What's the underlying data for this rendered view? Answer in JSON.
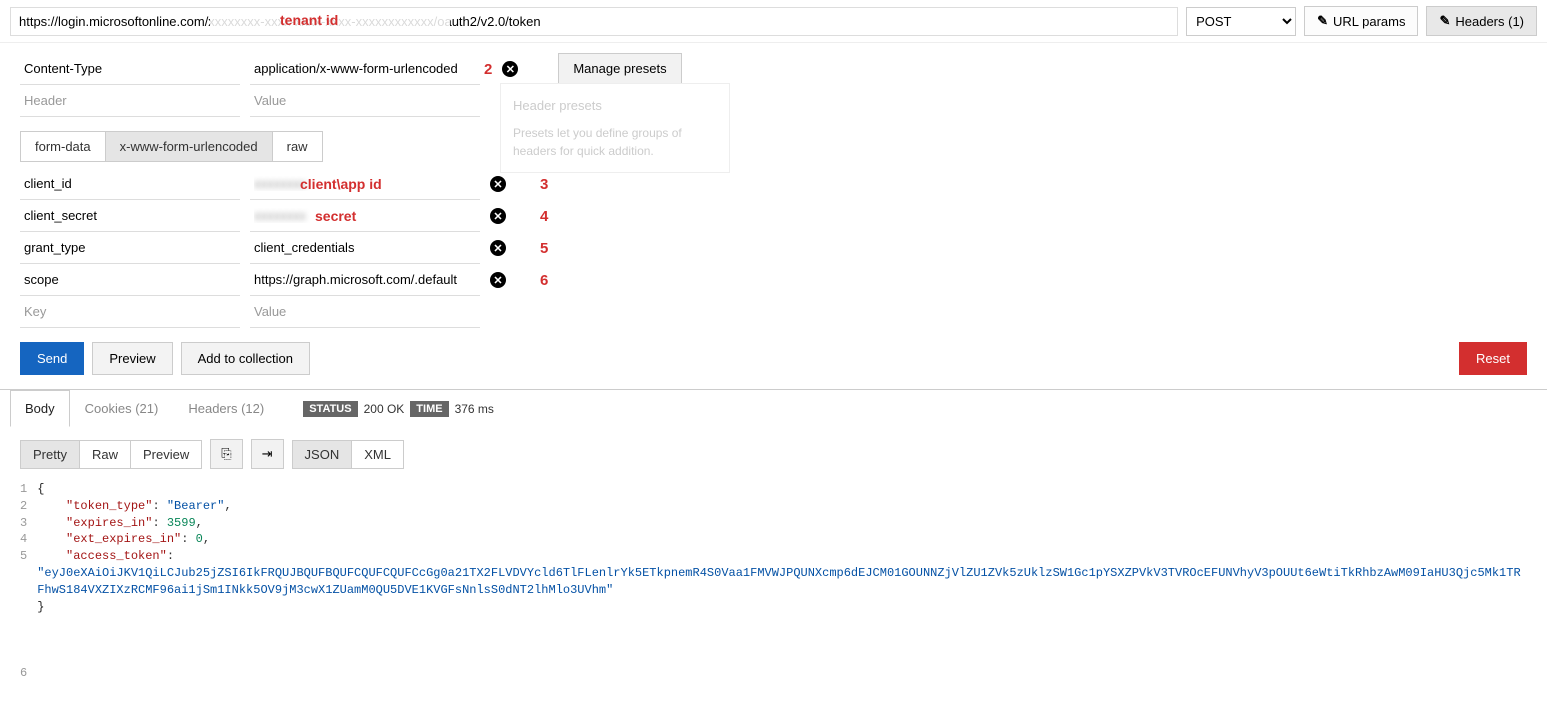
{
  "url": "https://login.microsoftonline.com/xxxxxxxx-xxxx-xxxx-xxxx-xxxxxxxxxxxx/oauth2/v2.0/token",
  "url_annotation": "tenant id",
  "method": "POST",
  "top_buttons": {
    "url_params": "URL params",
    "headers": "Headers (1)"
  },
  "headers": {
    "rows": [
      {
        "key": "Content-Type",
        "value": "application/x-www-form-urlencoded"
      }
    ],
    "placeholder_key": "Header",
    "placeholder_value": "Value",
    "annotation": "2"
  },
  "manage_presets": "Manage presets",
  "presets_tooltip": {
    "title": "Header presets",
    "body": "Presets let you define groups of headers for quick addition."
  },
  "body_tabs": {
    "form_data": "form-data",
    "urlencoded": "x-www-form-urlencoded",
    "raw": "raw"
  },
  "body_rows": [
    {
      "key": "client_id",
      "value": "",
      "overlay": "client\\app id",
      "annot": "3"
    },
    {
      "key": "client_secret",
      "value": "",
      "overlay": "secret",
      "annot": "4"
    },
    {
      "key": "grant_type",
      "value": "client_credentials",
      "overlay": "",
      "annot": "5"
    },
    {
      "key": "scope",
      "value": "https://graph.microsoft.com/.default",
      "overlay": "",
      "annot": "6"
    }
  ],
  "body_placeholder_key": "Key",
  "body_placeholder_value": "Value",
  "actions": {
    "send": "Send",
    "preview": "Preview",
    "add": "Add to collection",
    "reset": "Reset"
  },
  "response_tabs": {
    "body": "Body",
    "cookies": "Cookies (21)",
    "headers": "Headers (12)"
  },
  "status": {
    "label": "STATUS",
    "value": "200 OK",
    "time_label": "TIME",
    "time_value": "376 ms"
  },
  "response_toolbar": {
    "pretty": "Pretty",
    "raw": "Raw",
    "preview": "Preview",
    "json": "JSON",
    "xml": "XML"
  },
  "json_response": {
    "lines": [
      "1",
      "2",
      "3",
      "4",
      "5",
      "6"
    ],
    "token_type_key": "\"token_type\"",
    "token_type_val": "\"Bearer\"",
    "expires_in_key": "\"expires_in\"",
    "expires_in_val": "3599",
    "ext_expires_key": "\"ext_expires_in\"",
    "ext_expires_val": "0",
    "access_token_key": "\"access_token\"",
    "access_token_val": "\"eyJ0eXAiOiJKV1QiLCJub25jZSI6IkFRQUJBQUFBQUFCQUFCQUFCcGg0a21TX2FLVDVYcld6TlFLenlrYk5ETkpnemR4S0Vaa1FMVWJPQUNXcmp6dEJCM01GOUNNZjVlZU1ZVk5zUklzSW1Gc1pYSXZPVkV3TVROcEFUNVhyV3pOUUt6eWtiTkRhbzAwM09IaHU3Qjc5Mk1TRFhwS184VXZIXzRCMF96ai1jSm1INkk5OV9jM3cwX1ZUamM0QU5DVE1KVGFsNnlsS0dNT2lhMlo3UVhm\""
  }
}
